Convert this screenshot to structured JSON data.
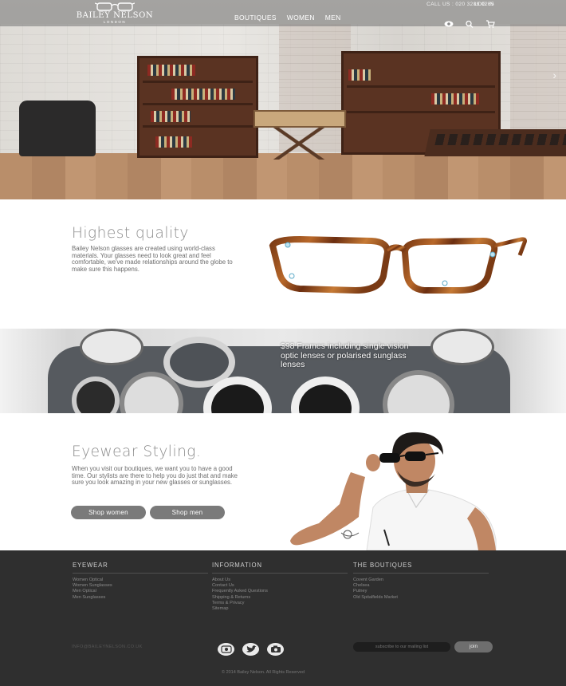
{
  "header": {
    "brand_name": "BAILEY NELSON",
    "brand_city": "LONDON",
    "nav": [
      "BOUTIQUES",
      "WOMEN",
      "MEN"
    ],
    "call": "CALL US : 020 3289 0265",
    "login": "LOG IN",
    "icons": [
      "eye-icon",
      "search-icon",
      "cart-icon"
    ]
  },
  "quality": {
    "title": "Highest quality",
    "body": "Bailey Nelson glasses are created using world-class materials. Your glasses need to look great and feel comfortable, we've made relationships around the globe to make sure this happens."
  },
  "promo": {
    "caption": "$98  Frames including single vision optic lenses or polarised sunglass lenses"
  },
  "styling": {
    "title": "Eyewear Styling.",
    "body": "When you visit our boutiques, we want you to have a good time. Our stylists are there to help you do just that and make sure you look amazing in your new glasses or sunglasses.",
    "shop_women": "Shop women",
    "shop_men": "Shop men"
  },
  "footer": {
    "columns": [
      {
        "title": "EYEWEAR",
        "links": [
          "Women Optical",
          "Women Sunglasses",
          "Men Optical",
          "Men Sunglasses"
        ]
      },
      {
        "title": "INFORMATION",
        "links": [
          "About Us",
          "Contact Us",
          "Frequently Asked Questions",
          "Shipping & Returns",
          "Terms & Privacy",
          "Sitemap"
        ]
      },
      {
        "title": "THE BOUTIQUES",
        "links": [
          "Covent Garden",
          "Chelsea",
          "Putney",
          "Old Spitalfields Market"
        ]
      }
    ],
    "site": "INFO@BAILEYNELSON.CO.UK",
    "social_icons": [
      "instagram-icon",
      "twitter-icon",
      "camera-icon"
    ],
    "subscribe_placeholder": "subscribe to our mailing list",
    "join": "join",
    "copyright": "© 2014 Bailey Nelson. All Rights Reserved"
  },
  "colors": {
    "footer_bg": "#2f2f2f",
    "button_grey": "#7a7a7a",
    "heading_grey": "#8c8c8c"
  }
}
